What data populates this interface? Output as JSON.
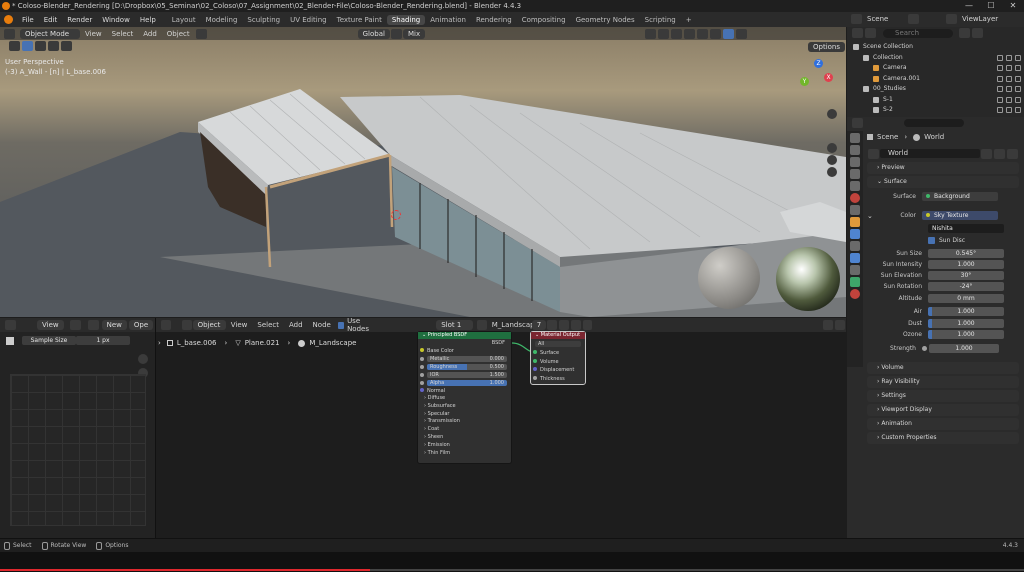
{
  "window": {
    "title": "* Coloso-Blender_Rendering [D:\\Dropbox\\05_Seminar\\02_Coloso\\07_Assignment\\02_Blender-File\\Coloso-Blender_Rendering.blend] - Blender 4.4.3",
    "minimize": "—",
    "maximize": "☐",
    "close": "✕"
  },
  "menubar": {
    "items": [
      "File",
      "Edit",
      "Render",
      "Window",
      "Help"
    ],
    "workspaces": [
      "Layout",
      "Modeling",
      "Sculpting",
      "UV Editing",
      "Texture Paint",
      "Shading",
      "Animation",
      "Rendering",
      "Compositing",
      "Geometry Nodes",
      "Scripting"
    ],
    "active_workspace": "Shading",
    "add_tab": "+",
    "scene_label": "Scene",
    "viewlayer_label": "ViewLayer"
  },
  "viewport": {
    "mode": "Object Mode",
    "menus": [
      "View",
      "Select",
      "Add",
      "Object"
    ],
    "transform_orientation": "Global",
    "blend_mode": "Mix",
    "options_button": "Options",
    "overlay_title": "User Perspective",
    "overlay_subtitle": "(-3) A_Wall - [n] | L_base.006",
    "gizmo_x": "X",
    "gizmo_y": "Y",
    "gizmo_z": "Z"
  },
  "image_editor": {
    "view_menu": "View",
    "new_button": "New",
    "open_button": "Ope",
    "sample_size_label": "Sample Size",
    "sample_size_value": "1 px"
  },
  "node_editor": {
    "object_dropdown": "Object",
    "menus": [
      "View",
      "Select",
      "Add",
      "Node"
    ],
    "use_nodes_label": "Use Nodes",
    "slot": "Slot 1",
    "material_name": "M_Landscape",
    "user_count": "7",
    "breadcrumb": [
      "L_base.006",
      "Plane.021",
      "M_Landscape"
    ],
    "bsdf_node": {
      "title": "Principled BSDF",
      "output": "BSDF",
      "base_color": "Base Color",
      "metallic_label": "Metallic",
      "metallic_value": "0.000",
      "roughness_label": "Roughness",
      "roughness_value": "0.500",
      "roughness_fill": 0.5,
      "ior_label": "IOR",
      "ior_value": "1.500",
      "alpha_label": "Alpha",
      "alpha_value": "1.000",
      "alpha_fill": 1.0,
      "normal": "Normal",
      "panels": [
        "Diffuse",
        "Subsurface",
        "Specular",
        "Transmission",
        "Coat",
        "Sheen",
        "Emission",
        "Thin Film"
      ]
    },
    "output_node": {
      "title": "Material Output",
      "target": "All",
      "inputs": [
        "Surface",
        "Volume",
        "Displacement",
        "Thickness"
      ]
    }
  },
  "outliner": {
    "search_placeholder": "Search",
    "items": [
      {
        "label": "Scene Collection",
        "indent": 0
      },
      {
        "label": "Collection",
        "indent": 1
      },
      {
        "label": "Camera",
        "indent": 2
      },
      {
        "label": "Camera.001",
        "indent": 2
      },
      {
        "label": "00_Studies",
        "indent": 1
      },
      {
        "label": "S-1",
        "indent": 2
      },
      {
        "label": "S-2",
        "indent": 2
      }
    ]
  },
  "properties": {
    "breadcrumb_scene": "Scene",
    "breadcrumb_world": "World",
    "world_name": "World",
    "panels_top": [
      "Preview",
      "Surface"
    ],
    "surface_label": "Surface",
    "surface_value": "Background",
    "color_label": "Color",
    "color_value": "Sky Texture",
    "sky_type": "Nishita",
    "sun_disc_label": "Sun Disc",
    "fields": [
      {
        "label": "Sun Size",
        "value": "0.545°"
      },
      {
        "label": "Sun Intensity",
        "value": "1.000"
      },
      {
        "label": "Sun Elevation",
        "value": "30°"
      },
      {
        "label": "Sun Rotation",
        "value": "-24°"
      },
      {
        "label": "Altitude",
        "value": "0 mm"
      },
      {
        "label": "Air",
        "value": "1.000"
      },
      {
        "label": "Dust",
        "value": "1.000"
      },
      {
        "label": "Ozone",
        "value": "1.000"
      }
    ],
    "strength_label": "Strength",
    "strength_value": "1.000",
    "panels_bottom": [
      "Volume",
      "Ray Visibility",
      "Settings",
      "Viewport Display",
      "Animation",
      "Custom Properties"
    ]
  },
  "statusbar": {
    "select": "Select",
    "rotate_view": "Rotate View",
    "options": "Options",
    "version": "4.4.3"
  },
  "colors": {
    "accent": "#4772b3",
    "header": "#2b2b2b",
    "node_green_header": "#1f6f3f",
    "node_red_header": "#7a2630"
  }
}
